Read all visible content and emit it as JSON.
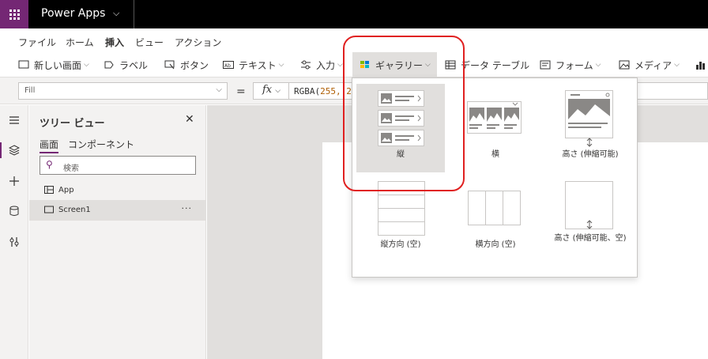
{
  "app": {
    "title": "Power Apps"
  },
  "menu_tabs": [
    "ファイル",
    "ホーム",
    "挿入",
    "ビュー",
    "アクション"
  ],
  "ribbon": {
    "new_screen": "新しい画面",
    "label": "ラベル",
    "button": "ボタン",
    "text": "テキスト",
    "input": "入力",
    "gallery": "ギャラリー",
    "data_table": "データ テーブル",
    "form": "フォーム",
    "media": "メディア"
  },
  "formula_bar": {
    "property": "Fill",
    "equals": "=",
    "fx": "fx",
    "formula_fn": "RGBA(",
    "formula_args": "255, 2"
  },
  "tree_view": {
    "title": "ツリー ビュー",
    "tab_screens": "画面",
    "tab_components": "コンポーネント",
    "search_placeholder": "検索",
    "items": [
      {
        "label": "App"
      },
      {
        "label": "Screen1",
        "more": "···"
      }
    ]
  },
  "gallery_menu": {
    "items": [
      {
        "label": "縦"
      },
      {
        "label": "横"
      },
      {
        "label": "高さ (伸縮可能)"
      },
      {
        "label": "縦方向 (空)"
      },
      {
        "label": "横方向 (空)"
      },
      {
        "label": "高さ (伸縮可能、空)"
      }
    ]
  },
  "colors": {
    "brand_purple": "#742774",
    "top_bar": "#000000",
    "annotation_red": "#e02020"
  }
}
